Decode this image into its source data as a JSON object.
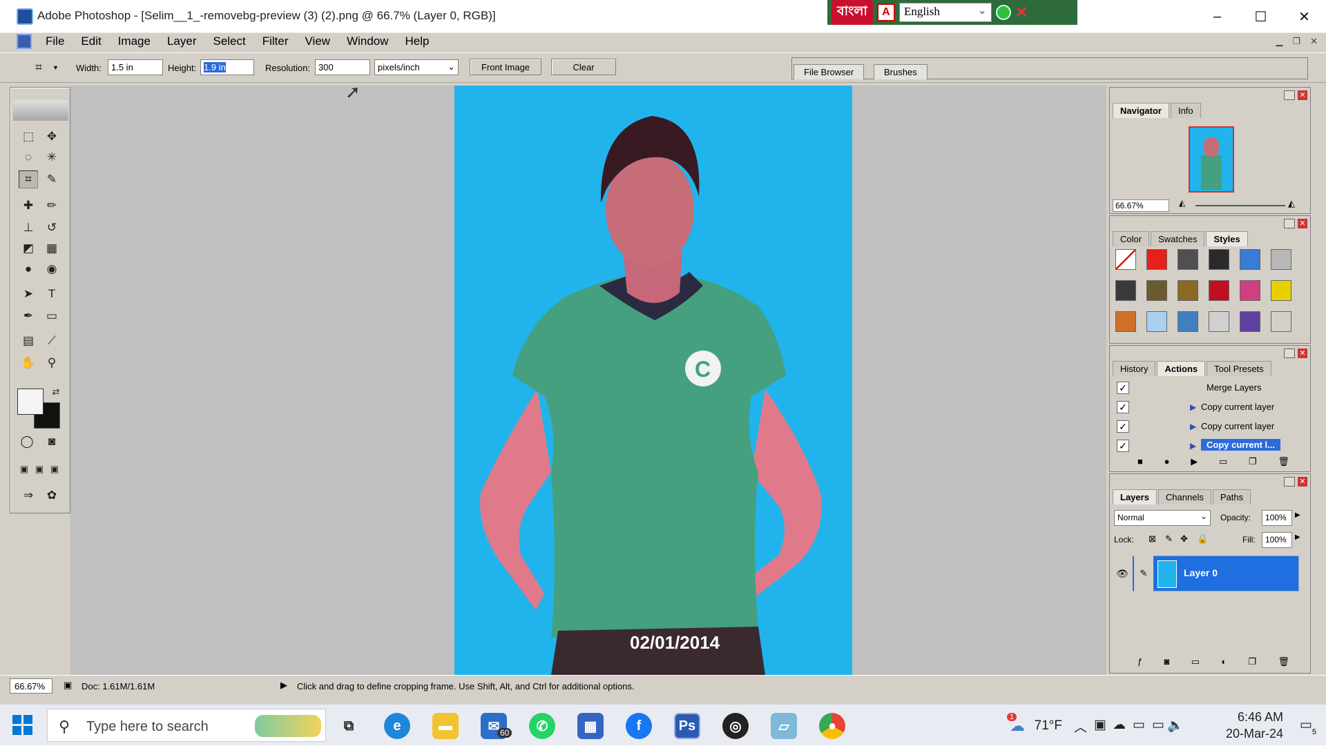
{
  "window": {
    "title": "Adobe Photoshop - [Selim__1_-removebg-preview (3) (2).png @ 66.7% (Layer 0, RGB)]",
    "controls": {
      "minimize": "–",
      "maximize": "☐",
      "close": "✕"
    }
  },
  "langbar": {
    "bangla": "বাংলা",
    "pdf": "A",
    "language": "English"
  },
  "menu": [
    "File",
    "Edit",
    "Image",
    "Layer",
    "Select",
    "Filter",
    "View",
    "Window",
    "Help"
  ],
  "options": {
    "width_label": "Width:",
    "width_value": "1.5 in",
    "height_label": "Height:",
    "height_value": "1.9 in",
    "resolution_label": "Resolution:",
    "resolution_value": "300",
    "unit_value": "pixels/inch",
    "front_image": "Front Image",
    "clear": "Clear"
  },
  "palette_well": [
    "File Browser",
    "Brushes"
  ],
  "navigator": {
    "tabs": [
      "Navigator",
      "Info"
    ],
    "zoom": "66.67%"
  },
  "styles_panel": {
    "tabs": [
      "Color",
      "Swatches",
      "Styles"
    ],
    "swatches": [
      "#ffffff",
      "#e8201c",
      "#505050",
      "#2a2a2a",
      "#3a7bd5",
      "#b8b8b8",
      "#3a3a3a",
      "#6a5a30",
      "#8a6a20",
      "#c01020",
      "#d04080",
      "#e8d000",
      "#d07028",
      "#a8d0f0",
      "#4080c0",
      "#d0d0d0",
      "#6040a0",
      "#d4d0c8"
    ]
  },
  "actions_panel": {
    "tabs": [
      "History",
      "Actions",
      "Tool Presets"
    ],
    "rows": [
      {
        "label": "Merge Layers",
        "checked": true,
        "arrow": false
      },
      {
        "label": "Copy current layer",
        "checked": true,
        "arrow": true
      },
      {
        "label": "Copy current layer",
        "checked": true,
        "arrow": true
      },
      {
        "label": "Copy current l...",
        "checked": true,
        "arrow": true,
        "selected": true
      }
    ]
  },
  "layers_panel": {
    "tabs": [
      "Layers",
      "Channels",
      "Paths"
    ],
    "blend_mode": "Normal",
    "opacity_label": "Opacity:",
    "opacity": "100%",
    "lock_label": "Lock:",
    "fill_label": "Fill:",
    "fill": "100%",
    "layer_name": "Layer 0"
  },
  "canvas": {
    "date_stamp": "02/01/2014",
    "background_color": "#21b4ec"
  },
  "status": {
    "zoom": "66.67%",
    "doc": "Doc: 1.61M/1.61M",
    "hint": "Click and drag to define cropping frame. Use Shift, Alt, and Ctrl for additional options."
  },
  "taskbar": {
    "search_placeholder": "Type here to search",
    "mail_badge": "60",
    "weather": "71°F",
    "weather_badge": "1",
    "time": "6:46 AM",
    "date": "20-Mar-24",
    "notif_badge": "5"
  }
}
